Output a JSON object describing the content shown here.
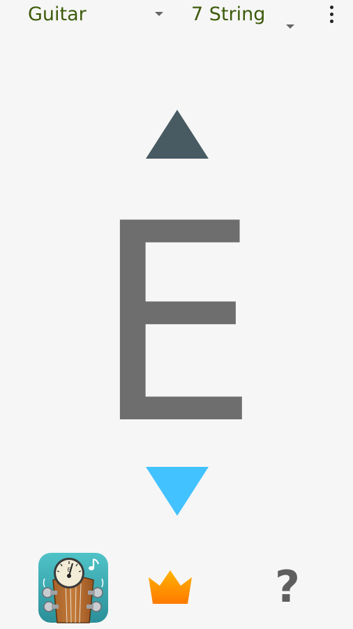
{
  "top_bar": {
    "instrument": "Guitar",
    "tuning": "7 String"
  },
  "tuner": {
    "note": "E",
    "colors": {
      "sharp_indicator": "#485a62",
      "flat_indicator": "#42c2ff",
      "note": "#6e6e6e"
    }
  },
  "bottom_bar": {
    "app_icon": "guitar-tuner-app-icon",
    "premium_icon": "crown-icon",
    "help_label": "?"
  },
  "colors": {
    "background": "#f6f6f6",
    "accent_text": "#3d5a0a"
  }
}
